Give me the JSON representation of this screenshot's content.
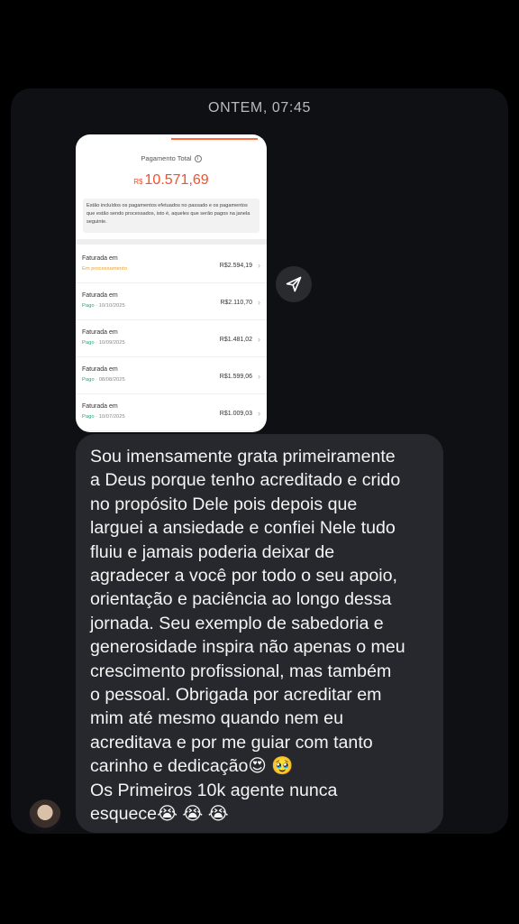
{
  "timestamp": "ONTEM, 07:45",
  "screenshot": {
    "header": "Pagamento Total",
    "info_icon": "info-icon",
    "currency": "R$",
    "total": "10.571,69",
    "note": "Estão incluídos os pagamentos efetuados no passado e os pagamentos que estão sendo processados, isto é, aqueles que serão pagos na janela seguinte.",
    "rows": [
      {
        "title": "Faturada em",
        "status": "Em processamento",
        "date": "",
        "amount": "R$2.594,19"
      },
      {
        "title": "Faturada em",
        "status": "Pago",
        "date": "10/10/2025",
        "amount": "R$2.110,70"
      },
      {
        "title": "Faturada em",
        "status": "Pago",
        "date": "10/09/2025",
        "amount": "R$1.481,02"
      },
      {
        "title": "Faturada em",
        "status": "Pago",
        "date": "08/08/2025",
        "amount": "R$1.599,06"
      },
      {
        "title": "Faturada em",
        "status": "Pago",
        "date": "10/07/2025",
        "amount": "R$1.009,03"
      }
    ]
  },
  "share_icon": "send-icon",
  "message": "Sou imensamente grata primeiramente\na Deus porque tenho acreditado e crido\nno propósito Dele pois depois que\nlarguei a ansiedade e confiei Nele tudo\nfluiu e jamais poderia deixar de\nagradecer a você por todo o seu apoio,\norientação e paciência ao longo dessa\njornada. Seu exemplo de sabedoria e\ngenerosidade inspira não apenas o meu\ncrescimento profissional, mas também\no pessoal. Obrigada por acreditar em\nmim até mesmo quando nem eu\nacreditava e por me guiar com tanto\ncarinho e dedicação😍 🥹\nOs Primeiros 10k agente nunca\nesquece😭 😭 😭",
  "avatar_icon": "avatar"
}
